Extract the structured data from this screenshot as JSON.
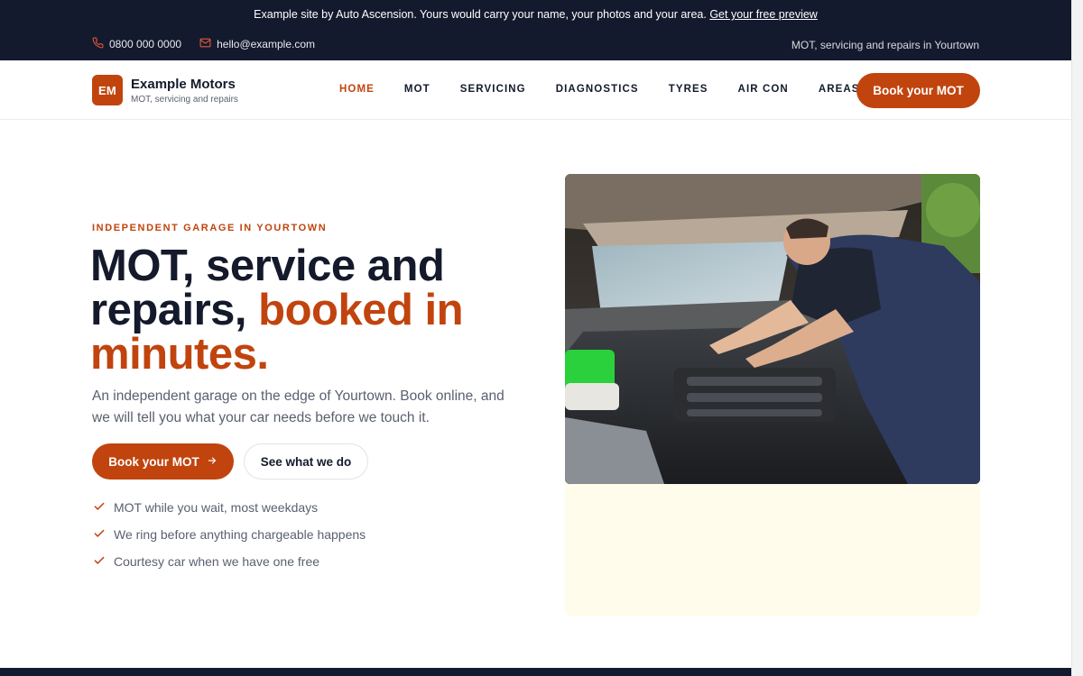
{
  "banner": {
    "text": "Example site by Auto Ascension. Yours would carry your name, your photos and your area.",
    "link": "Get your free preview"
  },
  "contact": {
    "phone": "0800 000 0000",
    "email": "hello@example.com",
    "tagline": "MOT, servicing and repairs in Yourtown"
  },
  "brand": {
    "initials": "EM",
    "name": "Example Motors",
    "sub": "MOT, servicing and repairs"
  },
  "nav": {
    "items": [
      {
        "label": "HOME",
        "active": true
      },
      {
        "label": "MOT"
      },
      {
        "label": "SERVICING"
      },
      {
        "label": "DIAGNOSTICS"
      },
      {
        "label": "TYRES"
      },
      {
        "label": "AIR CON"
      },
      {
        "label": "AREAS"
      }
    ],
    "cta": "Book your MOT"
  },
  "hero": {
    "eyebrow": "INDEPENDENT GARAGE IN YOURTOWN",
    "headline_part1": "MOT, service and repairs, ",
    "headline_accent": "booked in minutes.",
    "lede": "An independent garage on the edge of Yourtown. Book online, and we will tell you what your car needs before we touch it.",
    "primary_cta": "Book your MOT",
    "secondary_cta": "See what we do",
    "checks": [
      "MOT while you wait, most weekdays",
      "We ring before anything chargeable happens",
      "Courtesy car when we have one free"
    ]
  },
  "colors": {
    "accent": "#c1440e",
    "dark": "#141a2e",
    "card_bg": "#fffceb"
  },
  "icons": {
    "phone": "phone-icon",
    "email": "mail-icon",
    "arrow": "arrow-right-icon",
    "check": "check-icon"
  }
}
